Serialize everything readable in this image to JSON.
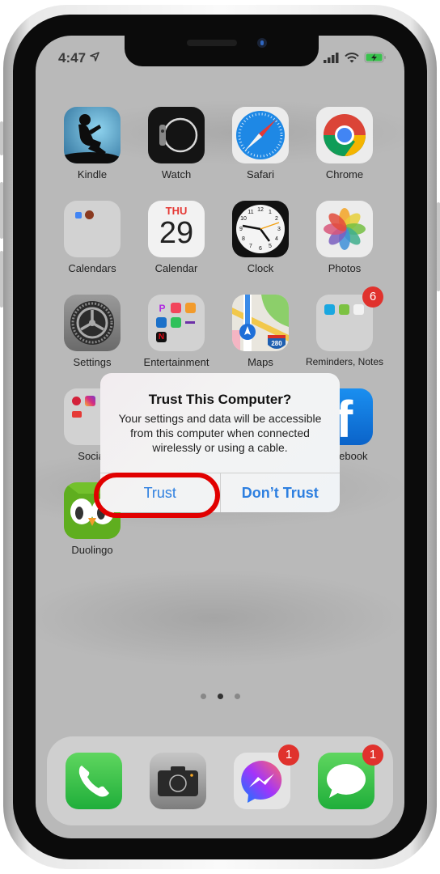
{
  "status_bar": {
    "time": "4:47",
    "location_icon": "location-arrow-icon",
    "signal_icon": "cellular-signal-icon",
    "wifi_icon": "wifi-icon",
    "battery_icon": "battery-charging-icon"
  },
  "apps": [
    {
      "label": "Kindle",
      "icon": "kindle-icon"
    },
    {
      "label": "Watch",
      "icon": "watch-icon"
    },
    {
      "label": "Safari",
      "icon": "safari-icon"
    },
    {
      "label": "Chrome",
      "icon": "chrome-icon"
    },
    {
      "label": "Calendars",
      "icon": "folder-icon"
    },
    {
      "label": "Calendar",
      "icon": "calendar-icon",
      "day": "THU",
      "date": "29"
    },
    {
      "label": "Clock",
      "icon": "clock-icon"
    },
    {
      "label": "Photos",
      "icon": "photos-icon"
    },
    {
      "label": "Settings",
      "icon": "settings-icon"
    },
    {
      "label": "Entertainment",
      "icon": "folder-icon"
    },
    {
      "label": "Maps",
      "icon": "maps-icon",
      "route": "280"
    },
    {
      "label": "Reminders, Notes",
      "icon": "folder-icon",
      "badge": "6"
    },
    {
      "label": "Social",
      "icon": "folder-icon"
    },
    {
      "label": "Facebook",
      "icon": "facebook-icon"
    },
    {
      "label": "Duolingo",
      "icon": "duolingo-icon"
    }
  ],
  "alert": {
    "title": "Trust This Computer?",
    "message": "Your settings and data will be accessible from this computer when connected wirelessly or using a cable.",
    "trust_label": "Trust",
    "dont_trust_label": "Don’t Trust"
  },
  "page_indicator": {
    "pages": 3,
    "current": 2
  },
  "dock": [
    {
      "label": "Phone",
      "icon": "phone-icon"
    },
    {
      "label": "Camera",
      "icon": "camera-icon"
    },
    {
      "label": "Messenger",
      "icon": "messenger-icon",
      "badge": "1"
    },
    {
      "label": "Messages",
      "icon": "messages-icon",
      "badge": "1"
    }
  ],
  "colors": {
    "alert_button": "#2d7fe0",
    "highlight_ring": "#e10000",
    "badge": "#e0322d"
  }
}
